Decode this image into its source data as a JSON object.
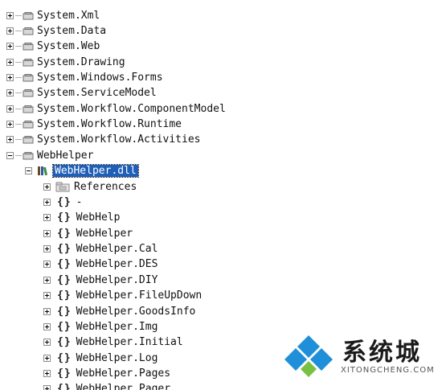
{
  "tree": {
    "top_items": [
      "System.Xml",
      "System.Data",
      "System.Web",
      "System.Drawing",
      "System.Windows.Forms",
      "System.ServiceModel",
      "System.Workflow.ComponentModel",
      "System.Workflow.Runtime",
      "System.Workflow.Activities",
      "WebHelper"
    ],
    "dll_label": "WebHelper.dll",
    "references_label": "References",
    "namespace_icon": "{}",
    "namespaces": [
      "-",
      "WebHelp",
      "WebHelper",
      "WebHelper.Cal",
      "WebHelper.DES",
      "WebHelper.DIY",
      "WebHelper.FileUpDown",
      "WebHelper.GoodsInfo",
      "WebHelper.Img",
      "WebHelper.Initial",
      "WebHelper.Log",
      "WebHelper.Pages",
      "WebHelper.Pager"
    ]
  },
  "watermark": {
    "title": "系统城",
    "subtitle": "XITONGCHENG.COM",
    "colors": {
      "blue": "#1e8fd8",
      "green": "#7ac143"
    }
  }
}
